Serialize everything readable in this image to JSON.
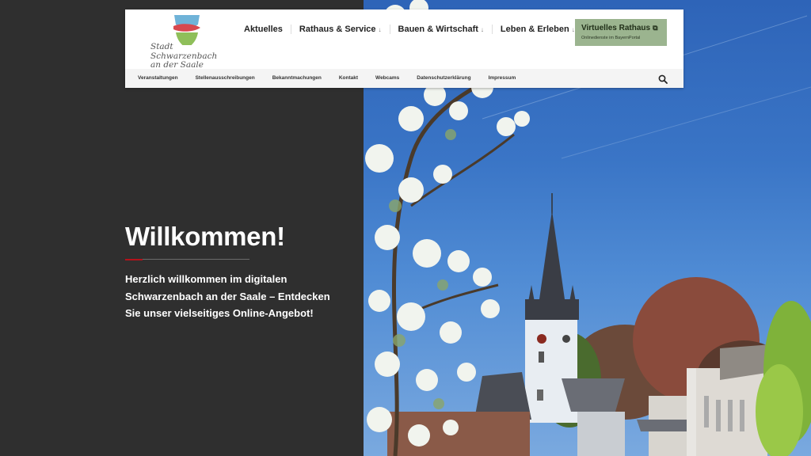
{
  "logo": {
    "line1": "Stadt",
    "line2": "Schwarzenbach",
    "line3": "an der Saale",
    "colors": {
      "blue": "#6fb3d8",
      "red": "#d7484f",
      "green": "#8fbf5a"
    }
  },
  "main_nav": [
    {
      "label": "Aktuelles",
      "has_dropdown": false
    },
    {
      "label": "Rathaus & Service",
      "has_dropdown": true,
      "arrow": "↓"
    },
    {
      "label": "Bauen & Wirtschaft",
      "has_dropdown": true,
      "arrow": "↓"
    },
    {
      "label": "Leben & Erleben",
      "has_dropdown": true,
      "arrow": "↓"
    }
  ],
  "cta": {
    "title": "Virtuelles Rathaus",
    "icon": "external-link-icon",
    "icon_glyph": "⧉",
    "subtitle": "Onlinedienste im BayernPortal",
    "color": "#9bb48f"
  },
  "sub_nav": [
    "Veranstaltungen",
    "Stellenausschreibungen",
    "Bekanntmachungen",
    "Kontakt",
    "Webcams",
    "Datenschutzerklärung",
    "Impressum"
  ],
  "search": {
    "icon": "search-icon"
  },
  "welcome": {
    "title": "Willkommen!",
    "text": "Herzlich willkommen im digitalen Schwarzenbach an der Saale – Entdecken Sie unser vielseitiges Online-Angebot!",
    "accent_color": "#b5121b"
  },
  "colors": {
    "panel": "#2f2f2f",
    "sky": "#3a75c6"
  }
}
